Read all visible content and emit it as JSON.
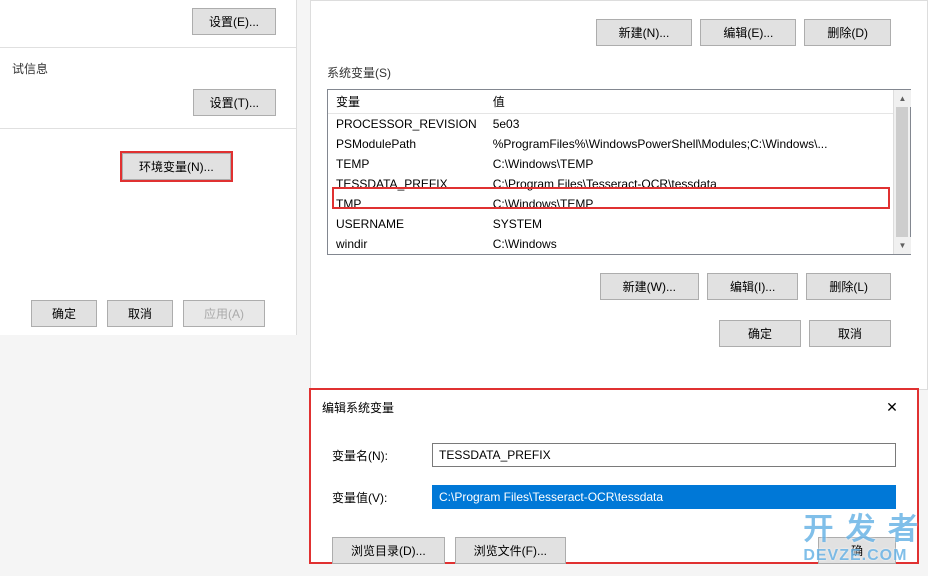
{
  "left": {
    "settings_e": "设置(E)...",
    "test_info": "试信息",
    "settings_t": "设置(T)...",
    "env_vars": "环境变量(N)...",
    "ok": "确定",
    "cancel": "取消",
    "apply": "应用(A)"
  },
  "env": {
    "top_buttons": {
      "new": "新建(N)...",
      "edit": "编辑(E)...",
      "delete": "删除(D)"
    },
    "sys_label": "系统变量(S)",
    "cols": {
      "var": "变量",
      "val": "值"
    },
    "rows": [
      {
        "var": "PROCESSOR_REVISION",
        "val": "5e03"
      },
      {
        "var": "PSModulePath",
        "val": "%ProgramFiles%\\WindowsPowerShell\\Modules;C:\\Windows\\..."
      },
      {
        "var": "TEMP",
        "val": "C:\\Windows\\TEMP"
      },
      {
        "var": "TESSDATA_PREFIX",
        "val": "C:\\Program Files\\Tesseract-OCR\\tessdata"
      },
      {
        "var": "TMP",
        "val": "C:\\Windows\\TEMP"
      },
      {
        "var": "USERNAME",
        "val": "SYSTEM"
      },
      {
        "var": "windir",
        "val": "C:\\Windows"
      }
    ],
    "bottom_buttons": {
      "new": "新建(W)...",
      "edit": "编辑(I)...",
      "delete": "删除(L)"
    },
    "footer": {
      "ok": "确定",
      "cancel": "取消"
    }
  },
  "edit": {
    "title": "编辑系统变量",
    "name_label": "变量名(N):",
    "name_value": "TESSDATA_PREFIX",
    "value_label": "变量值(V):",
    "value_value": "C:\\Program Files\\Tesseract-OCR\\tessdata",
    "browse_dir": "浏览目录(D)...",
    "browse_file": "浏览文件(F)...",
    "ok": "确"
  },
  "watermark": {
    "main": "开 发 者",
    "sub": "DEVZE.COM"
  }
}
